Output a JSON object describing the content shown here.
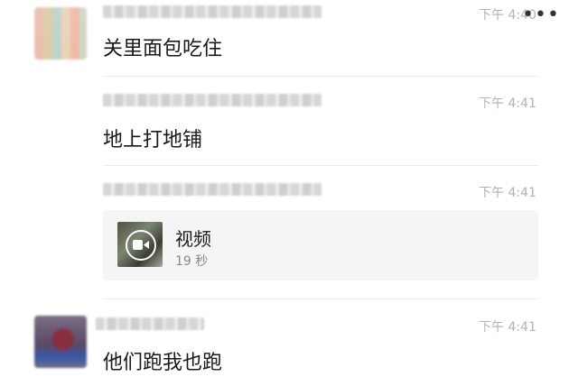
{
  "header": {
    "more_glyph": "•••"
  },
  "messages": [
    {
      "time": "下午 4:40",
      "text": "关里面包吃住"
    },
    {
      "time": "下午 4:41",
      "text": "地上打地铺"
    },
    {
      "time": "下午 4:41",
      "video": {
        "title": "视频",
        "duration": "19 秒"
      }
    },
    {
      "time": "下午 4:41",
      "text": "他们跑我也跑"
    }
  ],
  "icons": [
    "more-options-icon",
    "video-play-icon"
  ],
  "colors": {
    "timestamp": "#b2b2b2",
    "card_background": "#f5f5f5"
  }
}
